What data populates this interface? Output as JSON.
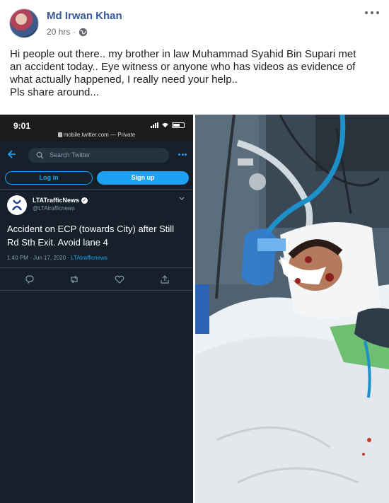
{
  "post": {
    "author": "Md Irwan Khan",
    "time": "20 hrs",
    "separator": "·",
    "text_lines": [
      "Hi people out there.. my brother in law Muhammad Syahid Bin Supari met",
      "an accident today.. Eye witness or anyone who has videos as evidence of",
      "what actually happened, I really need your help..",
      "Pls share around..."
    ]
  },
  "screenshot": {
    "status_time": "9:01",
    "url": "mobile.twitter.com — Private",
    "search_placeholder": "Search Twitter",
    "login_label": "Log in",
    "signup_label": "Sign up",
    "tweet": {
      "name": "LTATrafficNews",
      "handle": "@LTAtrafficnews",
      "text": "Accident on ECP (towards City) after Still Rd Sth Exit. Avoid lane 4",
      "date": "1:40 PM · Jun 17, 2020 · ",
      "source": "LTAtrafficnews"
    }
  },
  "colors": {
    "author": "#385898",
    "twitter_bg": "#15202b",
    "twitter_blue": "#1da1f2"
  },
  "icons": [
    "globe-icon",
    "more-options-icon",
    "back-arrow-icon",
    "search-icon",
    "reply-icon",
    "retweet-icon",
    "like-icon",
    "share-icon"
  ]
}
